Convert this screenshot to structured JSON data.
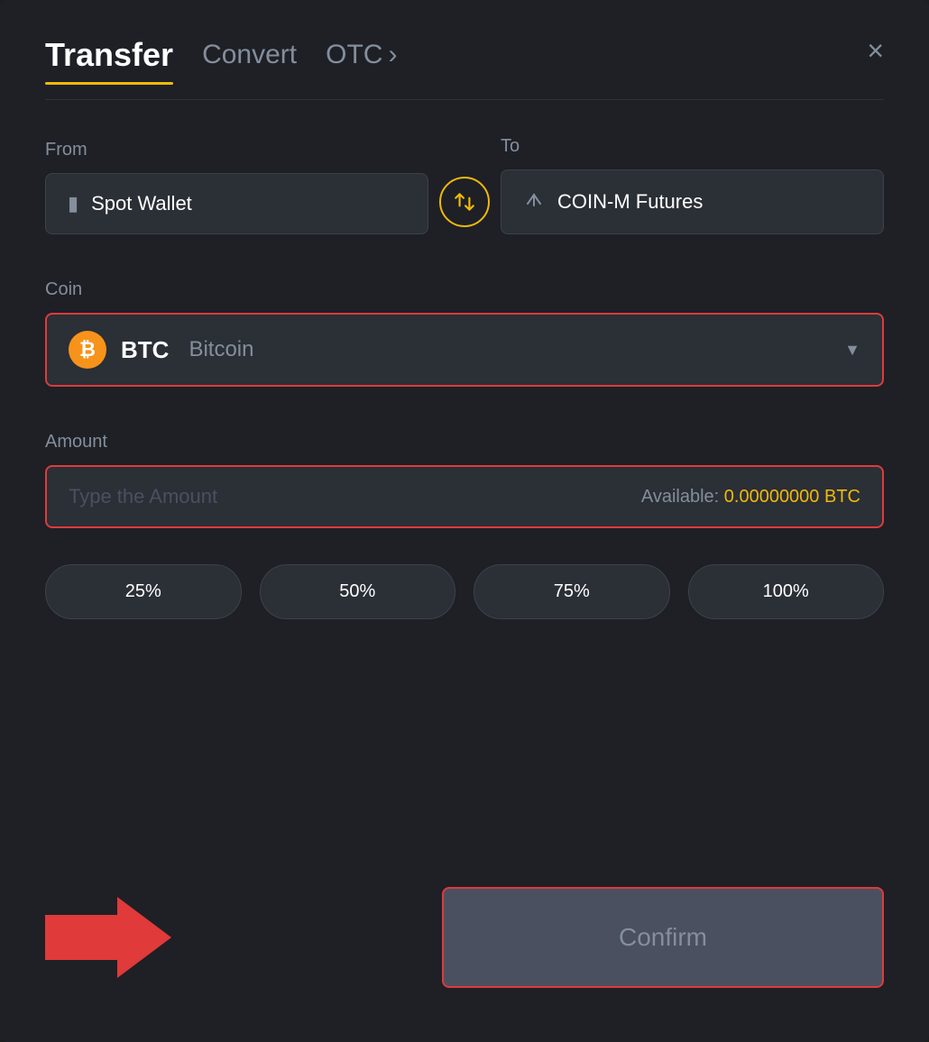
{
  "header": {
    "transfer_label": "Transfer",
    "convert_label": "Convert",
    "otc_label": "OTC",
    "otc_chevron": "›",
    "close_icon": "×"
  },
  "from_section": {
    "label": "From",
    "wallet_name": "Spot Wallet",
    "wallet_icon": "▤"
  },
  "to_section": {
    "label": "To",
    "wallet_name": "COIN-M Futures",
    "wallet_icon": "↑"
  },
  "swap": {
    "icon": "⇄"
  },
  "coin_section": {
    "label": "Coin",
    "coin_symbol": "BTC",
    "coin_name": "Bitcoin",
    "coin_letter": "₿"
  },
  "amount_section": {
    "label": "Amount",
    "placeholder": "Type the Amount",
    "available_label": "Available:",
    "available_value": "0.00000000 BTC"
  },
  "percent_buttons": [
    {
      "label": "25%",
      "value": "25"
    },
    {
      "label": "50%",
      "value": "50"
    },
    {
      "label": "75%",
      "value": "75"
    },
    {
      "label": "100%",
      "value": "100"
    }
  ],
  "confirm": {
    "label": "Confirm"
  }
}
